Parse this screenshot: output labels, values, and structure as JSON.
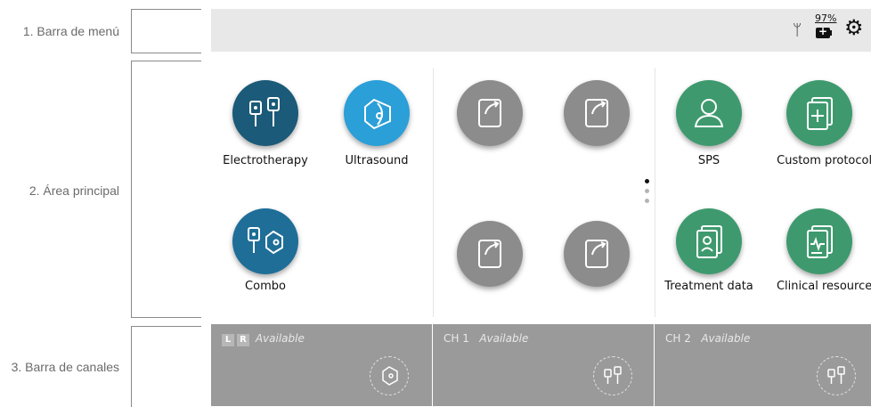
{
  "annotations": {
    "menu_bar": "1. Barra de menú",
    "main_area": "2. Área principal",
    "channel_bar": "3. Barra de canales"
  },
  "menubar": {
    "usb_icon": "usb-icon",
    "battery_percent": "97%",
    "battery_icon": "battery-charging-icon",
    "settings_icon": "gear-icon"
  },
  "apps": {
    "electrotherapy": "Electrotherapy",
    "ultrasound": "Ultrasound",
    "combo": "Combo",
    "sps": "SPS",
    "custom_protocols": "Custom protocols",
    "treatment_data": "Treatment data",
    "clinical_resources": "Clinical resources"
  },
  "page_indicator": {
    "pages": 3,
    "active": 1
  },
  "channels": {
    "ultrasound": {
      "left": "L",
      "right": "R",
      "status": "Available"
    },
    "ch1": {
      "name": "CH 1",
      "status": "Available"
    },
    "ch2": {
      "name": "CH 2",
      "status": "Available"
    }
  },
  "colors": {
    "electro_blue": "#1b5a78",
    "ultrasound_blue": "#2a9fd8",
    "gray_tile": "#8c8c8c",
    "green_tile": "#3e9a6e",
    "channel_bar": "#9a9a9a"
  }
}
